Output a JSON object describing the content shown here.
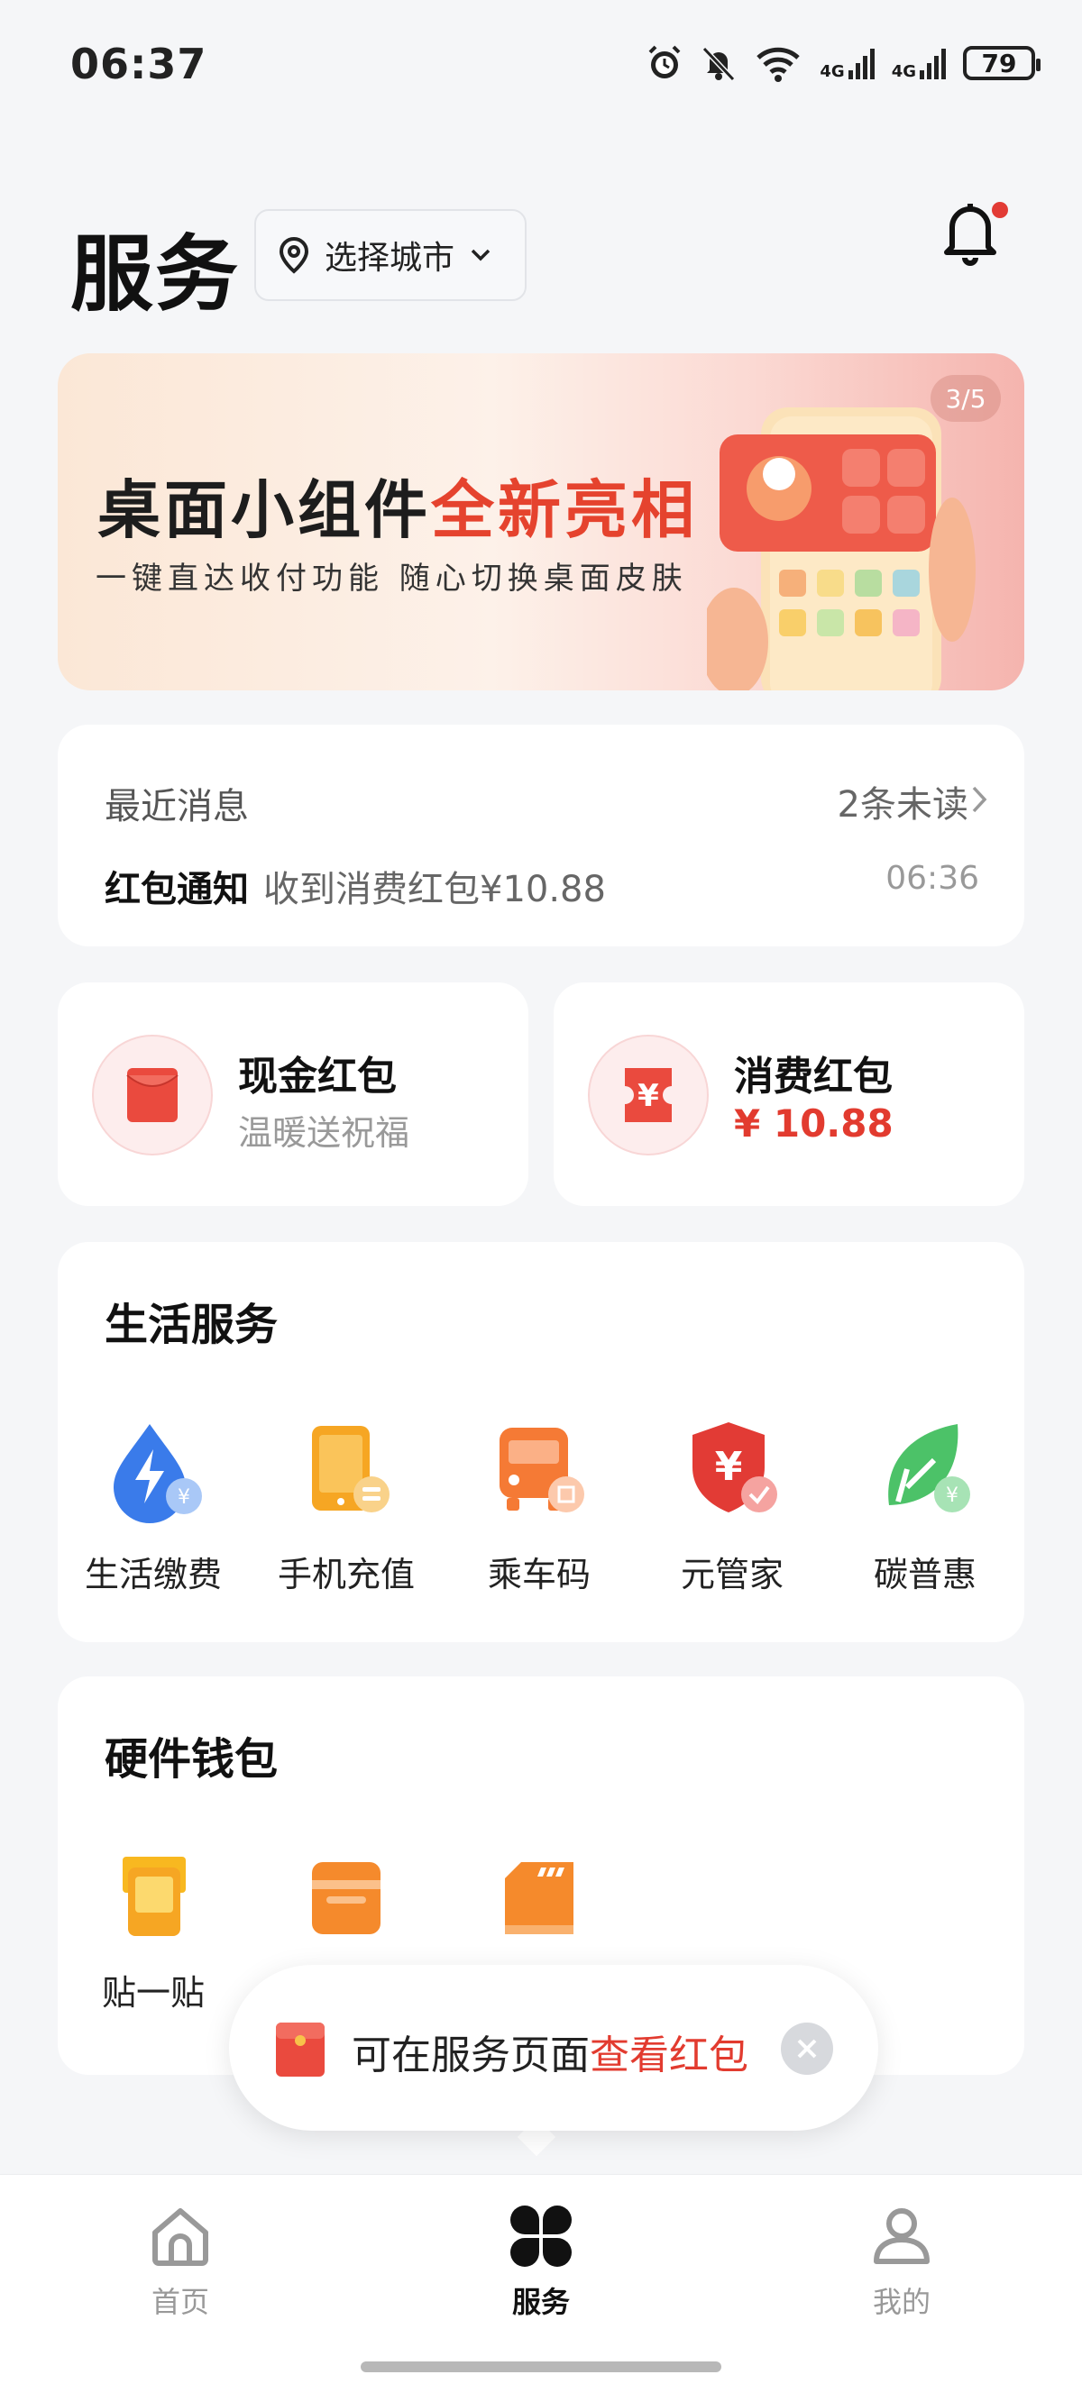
{
  "status_bar": {
    "time": "06:37",
    "battery": "79",
    "network_1": "4G",
    "network_2": "4G"
  },
  "header": {
    "title": "服务",
    "city_selector": "选择城市",
    "bell_has_dot": true
  },
  "banner": {
    "title_main": "桌面小组件",
    "title_accent": "全新亮相",
    "subtitle": "一键直达收付功能  随心切换桌面皮肤",
    "counter": "3/5"
  },
  "messages": {
    "heading": "最近消息",
    "unread": "2条未读",
    "type": "红包通知",
    "text": "收到消费红包¥10.88",
    "time": "06:36"
  },
  "red_packets": {
    "cash": {
      "title": "现金红包",
      "subtitle": "温暖送祝福"
    },
    "consume": {
      "title": "消费红包",
      "amount": "¥ 10.88"
    }
  },
  "life_services": {
    "title": "生活服务",
    "items": [
      {
        "label": "生活缴费",
        "icon": "bolt-yuan-icon"
      },
      {
        "label": "手机充值",
        "icon": "phone-coin-icon"
      },
      {
        "label": "乘车码",
        "icon": "bus-qr-icon"
      },
      {
        "label": "元管家",
        "icon": "shield-yuan-icon"
      },
      {
        "label": "碳普惠",
        "icon": "leaf-yuan-icon"
      }
    ]
  },
  "hardware_wallet": {
    "title": "硬件钱包",
    "items": [
      {
        "label": "贴一贴",
        "icon": "tap-phone-icon"
      },
      {
        "label": "",
        "icon": "wallet-card-icon"
      },
      {
        "label": "",
        "icon": "sd-card-icon"
      }
    ]
  },
  "toast": {
    "text": "可在服务页面",
    "link": "查看红包"
  },
  "tabbar": {
    "home": "首页",
    "services": "服务",
    "mine": "我的"
  },
  "colors": {
    "accent_red": "#E23B2F",
    "orange": "#F58A2C",
    "background": "#F5F6F8"
  }
}
